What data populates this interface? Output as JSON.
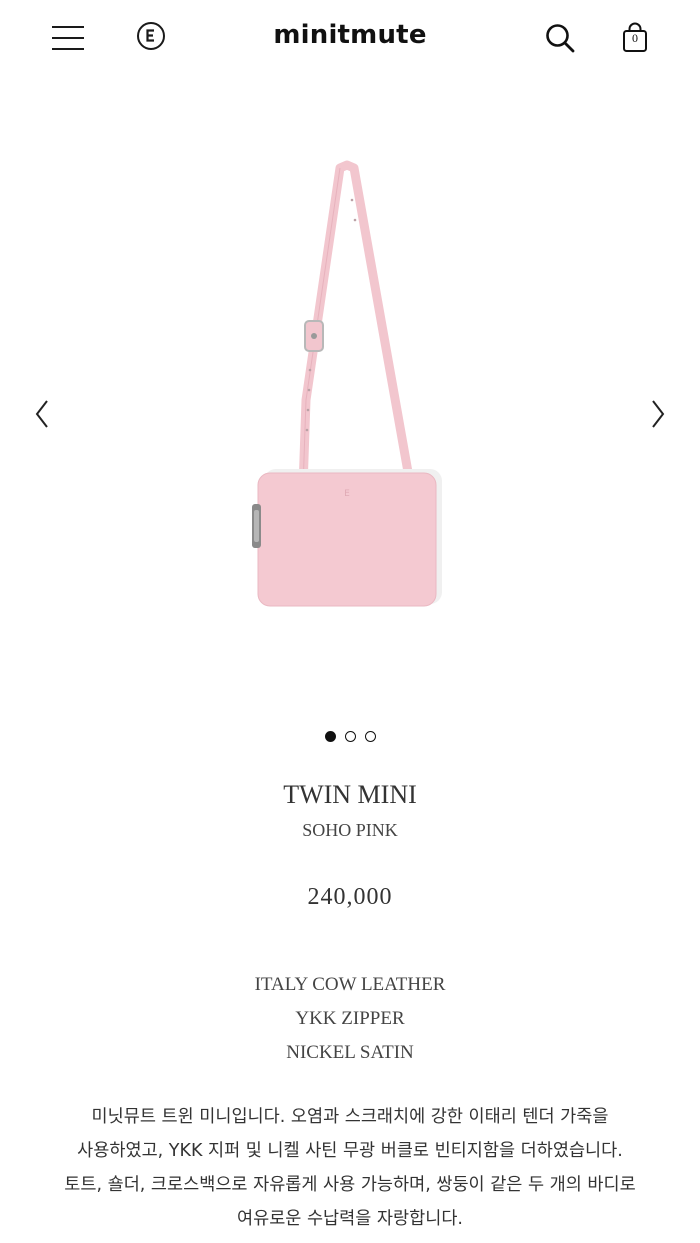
{
  "header": {
    "brand": "minitmute",
    "cart_count": "0",
    "icons": [
      "menu-icon",
      "brand-e-icon",
      "search-icon",
      "shopping-bag-icon"
    ]
  },
  "gallery": {
    "slide_count": 3,
    "active_slide": 1,
    "bag_color": "#f4c9d1"
  },
  "product": {
    "name": "TWIN MINI",
    "color": "SOHO PINK",
    "price": "240,000",
    "specs": [
      "ITALY COW LEATHER",
      "YKK ZIPPER",
      "NICKEL SATIN"
    ],
    "description": "미닛뮤트 트윈 미니입니다. 오염과 스크래치에 강한 이태리 텐더 가죽을 사용하였고, YKK 지퍼 및 니켈 사틴 무광 버클로 빈티지함을 더하였습니다. 토트, 숄더, 크로스백으로 자유롭게 사용 가능하며, 쌍둥이 같은 두 개의 바디로 여유로운 수납력을 자랑합니다."
  }
}
